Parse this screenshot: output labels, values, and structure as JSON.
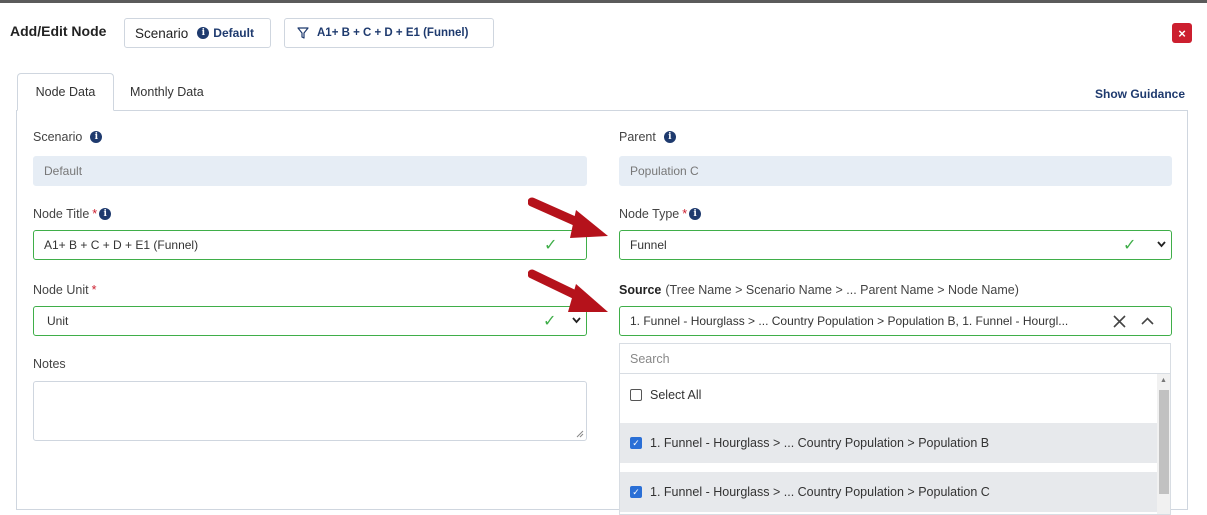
{
  "header": {
    "title": "Add/Edit Node",
    "scenario_label": "Scenario",
    "scenario_value": "Default",
    "tree_label": "A1+ B + C + D + E1 (Funnel)",
    "close_label": "×"
  },
  "tabs": [
    {
      "label": "Node Data",
      "active": true
    },
    {
      "label": "Monthly Data",
      "active": false
    }
  ],
  "show_guidance": "Show Guidance",
  "form": {
    "scenario": {
      "label": "Scenario",
      "value": "Default"
    },
    "parent": {
      "label": "Parent",
      "value": "Population C"
    },
    "node_title": {
      "label": "Node Title",
      "required_mark": "*",
      "value": "A1+ B + C + D + E1 (Funnel)"
    },
    "node_type": {
      "label": "Node Type",
      "required_mark": "*",
      "value": "Funnel"
    },
    "node_unit": {
      "label": "Node Unit",
      "required_mark": "*",
      "value": "Unit"
    },
    "source": {
      "label_bold": "Source",
      "label_rest": "(Tree Name > Scenario Name > ... Parent Name > Node Name)",
      "value": "1. Funnel - Hourglass > ... Country Population > Population B, 1. Funnel - Hourgl..."
    },
    "notes": {
      "label": "Notes",
      "value": ""
    }
  },
  "dropdown": {
    "search_placeholder": "Search",
    "select_all": "Select All",
    "options": [
      {
        "label": "1. Funnel - Hourglass > ... Country Population > Population B",
        "checked": true
      },
      {
        "label": "1. Funnel - Hourglass > ... Country Population > Population C",
        "checked": true
      }
    ]
  },
  "icons": {
    "info": "info-circle-icon",
    "check": "checkmark-icon",
    "chevron_down": "chevron-down-icon",
    "chevron_up": "chevron-up-icon",
    "clear": "x-clear-icon",
    "filter": "funnel-filter-icon",
    "arrow": "red-arrow-icon"
  },
  "colors": {
    "accent": "#1e3a6e",
    "valid": "#3fae49",
    "danger": "#cc1f2f",
    "annotation_arrow": "#b5121b"
  }
}
